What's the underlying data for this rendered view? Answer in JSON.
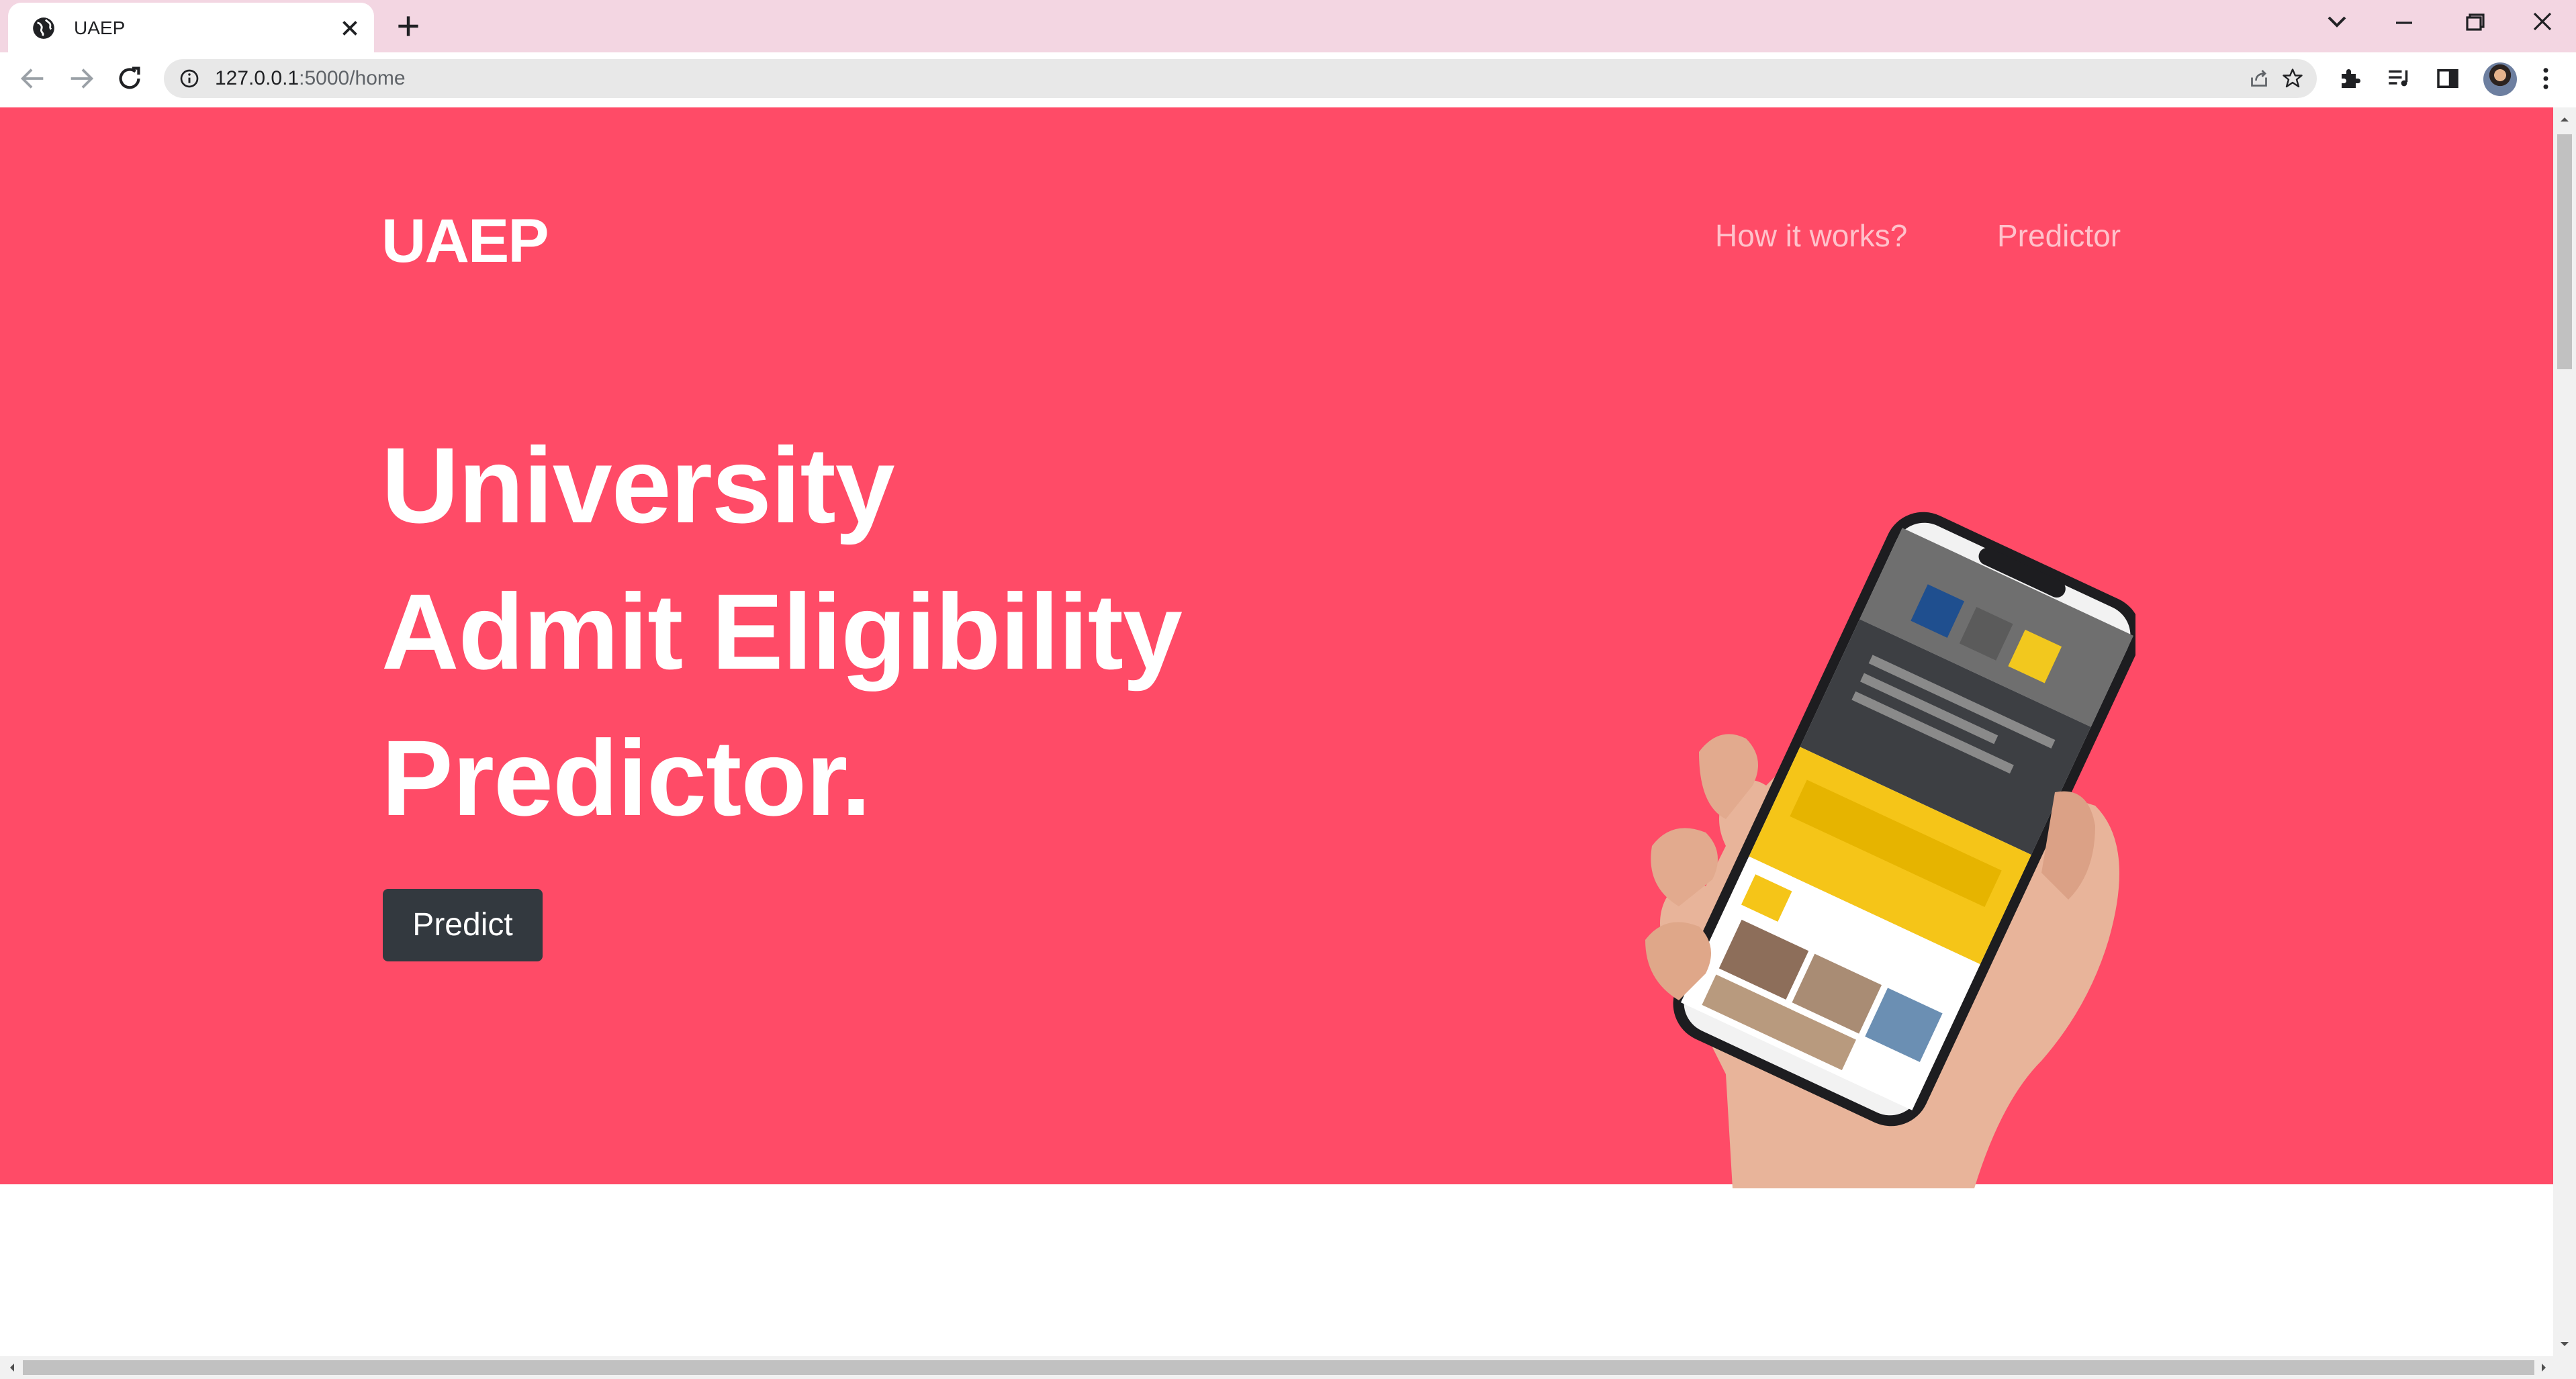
{
  "browser": {
    "tab": {
      "title": "UAEP",
      "favicon": "globe-icon"
    },
    "url": {
      "host": "127.0.0.1",
      "path": ":5000/home"
    },
    "icons": {
      "back": "arrow-left-icon",
      "forward": "arrow-right-icon",
      "reload": "reload-icon",
      "share": "share-icon",
      "bookmark": "star-icon",
      "extensions": "puzzle-icon",
      "media": "playlist-icon",
      "side_panel": "side-panel-icon",
      "menu": "kebab-menu-icon"
    }
  },
  "site": {
    "brand": "UAEP",
    "nav": [
      {
        "label": "How it works?"
      },
      {
        "label": "Predictor"
      }
    ],
    "hero": {
      "title_lines": [
        "University",
        "Admit Eligibility",
        "Predictor."
      ],
      "cta_label": "Predict"
    }
  },
  "colors": {
    "hero_bg": "#ff4b67",
    "cta_bg": "#33393f",
    "tabstrip_bg": "#f3d6e2"
  }
}
